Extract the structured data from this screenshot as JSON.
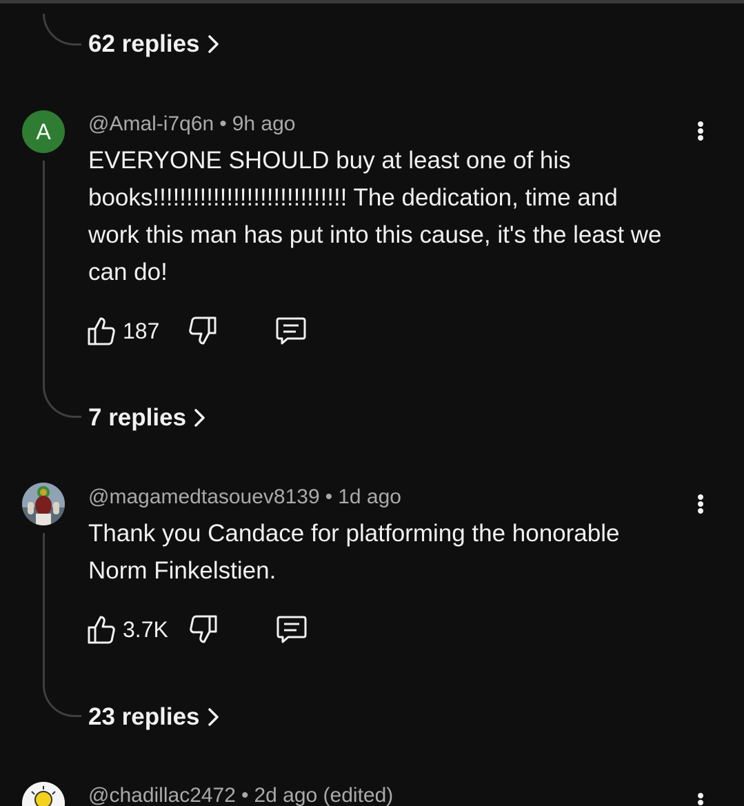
{
  "thread_top": {
    "replies_label": "62 replies"
  },
  "comments": [
    {
      "avatar_letter": "A",
      "avatar_color": "#2e7d32",
      "handle": "@Amal-i7q6n",
      "time": "9h ago",
      "lines": [
        "EVERYONE SHOULD buy at least one of his",
        "books!!!!!!!!!!!!!!!!!!!!!!!!!!!!!  The dedication, time and",
        "work this man has put into this cause, it's the least we",
        "can do!"
      ],
      "likes": "187",
      "replies_label": "7 replies"
    },
    {
      "avatar_icon": "profile-photo",
      "handle": "@magamedtasouev8139",
      "time": "1d ago",
      "lines": [
        "Thank you Candace for platforming the honorable",
        "Norm Finkelstien."
      ],
      "likes": "3.7K",
      "replies_label": "23 replies"
    },
    {
      "avatar_icon": "lightbulb-avatar",
      "handle": "@chadillac2472",
      "time": "2d ago (edited)"
    }
  ]
}
